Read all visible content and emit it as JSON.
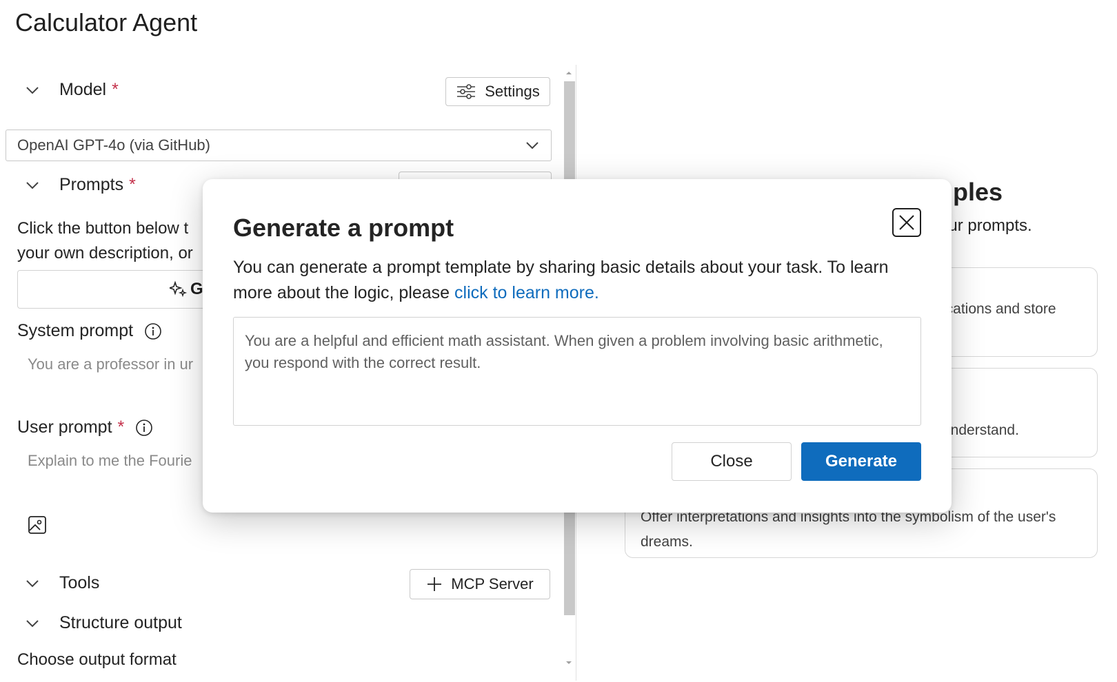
{
  "app": {
    "title": "Calculator Agent"
  },
  "model": {
    "label": "Model",
    "required_mark": "*",
    "settings_label": "Settings",
    "selected": "OpenAI GPT-4o (via GitHub)"
  },
  "prompts": {
    "label": "Prompts",
    "required_mark": "*",
    "help_line1": "Click the button below t",
    "help_line2": "your own description, or",
    "generate_button_partial": "G",
    "system_prompt_label": "System prompt",
    "system_prompt_placeholder": "You are a professor in ur",
    "user_prompt_label": "User prompt",
    "user_prompt_required": "*",
    "user_prompt_placeholder": "Explain to me the Fourie"
  },
  "tools": {
    "label": "Tools",
    "mcp_label": "MCP Server"
  },
  "structure": {
    "label": "Structure output",
    "choose_format": "Choose output format"
  },
  "examples": {
    "heading_partial": "mples",
    "subheading_partial": "your prompts.",
    "cards": [
      {
        "text": "ications and store"
      },
      {
        "text": "understand."
      },
      {
        "text": "Offer interpretations and insights into the symbolism of the user's dreams."
      }
    ]
  },
  "modal": {
    "title": "Generate a prompt",
    "description": "You can generate a prompt template by sharing basic details about your task. To learn more about the logic, please ",
    "link_text": "click to learn more.",
    "input_value": "You are a helpful and efficient math assistant. When given a problem involving basic arithmetic, you respond with the correct result.",
    "close_label": "Close",
    "generate_label": "Generate"
  },
  "colors": {
    "accent": "#0f6cbd",
    "required": "#c4314b"
  }
}
